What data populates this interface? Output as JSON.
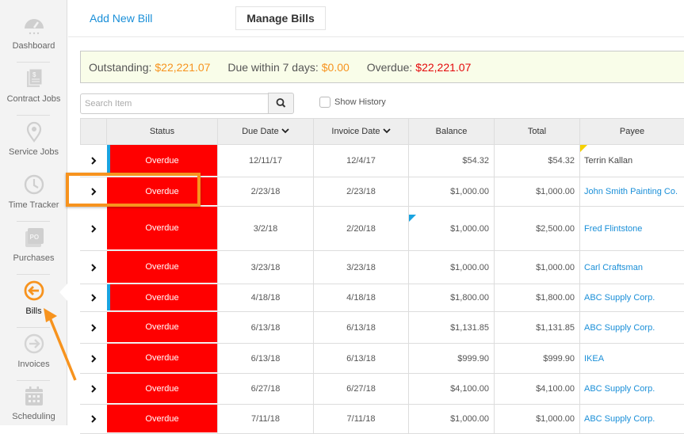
{
  "sidebar": {
    "items": [
      {
        "label": "Dashboard",
        "icon": "dashboard-gauge-icon"
      },
      {
        "label": "Contract Jobs",
        "icon": "contract-document-icon"
      },
      {
        "label": "Service Jobs",
        "icon": "map-pin-icon"
      },
      {
        "label": "Time Tracker",
        "icon": "clock-icon"
      },
      {
        "label": "Purchases",
        "icon": "po-icon",
        "icon_text": "PO"
      },
      {
        "label": "Bills",
        "icon": "arrow-left-circle-icon",
        "active": true
      },
      {
        "label": "Invoices",
        "icon": "arrow-right-circle-icon"
      },
      {
        "label": "Scheduling",
        "icon": "calendar-icon"
      }
    ]
  },
  "tabs": {
    "add_label": "Add New Bill",
    "manage_label": "Manage Bills"
  },
  "summary": {
    "outstanding_label": "Outstanding:",
    "outstanding_value": "$22,221.07",
    "due7_label": "Due within 7 days:",
    "due7_value": "$0.00",
    "overdue_label": "Overdue:",
    "overdue_value": "$22,221.07"
  },
  "toolbar": {
    "search_placeholder": "Search Item",
    "show_history_label": "Show History",
    "show_history_checked": false
  },
  "table": {
    "columns": [
      "",
      "Status",
      "Due Date",
      "Invoice Date",
      "Balance",
      "Total",
      "Payee"
    ],
    "sortable": [
      "Due Date",
      "Invoice Date"
    ],
    "rows": [
      {
        "status": "Overdue",
        "due": "12/11/17",
        "invoice": "12/4/17",
        "balance": "$54.32",
        "total": "$54.32",
        "payee": "Terrin Kallan",
        "payee_link": false,
        "blue_flag": true,
        "yellow_corner": true
      },
      {
        "status": "Overdue",
        "due": "2/23/18",
        "invoice": "2/23/18",
        "balance": "$1,000.00",
        "total": "$1,000.00",
        "payee": "John Smith Painting Co.",
        "payee_link": true
      },
      {
        "status": "Overdue",
        "due": "3/2/18",
        "invoice": "2/20/18",
        "balance": "$1,000.00",
        "total": "$2,500.00",
        "payee": "Fred Flintstone",
        "payee_link": true,
        "blue_corner": true
      },
      {
        "status": "Overdue",
        "due": "3/23/18",
        "invoice": "3/23/18",
        "balance": "$1,000.00",
        "total": "$1,000.00",
        "payee": "Carl Craftsman",
        "payee_link": true
      },
      {
        "status": "Overdue",
        "due": "4/18/18",
        "invoice": "4/18/18",
        "balance": "$1,800.00",
        "total": "$1,800.00",
        "payee": "ABC Supply Corp.",
        "payee_link": true,
        "blue_flag": true
      },
      {
        "status": "Overdue",
        "due": "6/13/18",
        "invoice": "6/13/18",
        "balance": "$1,131.85",
        "total": "$1,131.85",
        "payee": "ABC Supply Corp.",
        "payee_link": true
      },
      {
        "status": "Overdue",
        "due": "6/13/18",
        "invoice": "6/13/18",
        "balance": "$999.90",
        "total": "$999.90",
        "payee": "IKEA",
        "payee_link": true
      },
      {
        "status": "Overdue",
        "due": "6/27/18",
        "invoice": "6/27/18",
        "balance": "$4,100.00",
        "total": "$4,100.00",
        "payee": "ABC Supply Corp.",
        "payee_link": true
      },
      {
        "status": "Overdue",
        "due": "7/11/18",
        "invoice": "7/11/18",
        "balance": "$1,000.00",
        "total": "$1,000.00",
        "payee": "ABC Supply Corp.",
        "payee_link": true
      }
    ]
  },
  "colors": {
    "accent_orange": "#f7931e",
    "link_blue": "#1a8fd8",
    "overdue_red": "#ff0000",
    "summary_bg": "#f9fde9"
  }
}
